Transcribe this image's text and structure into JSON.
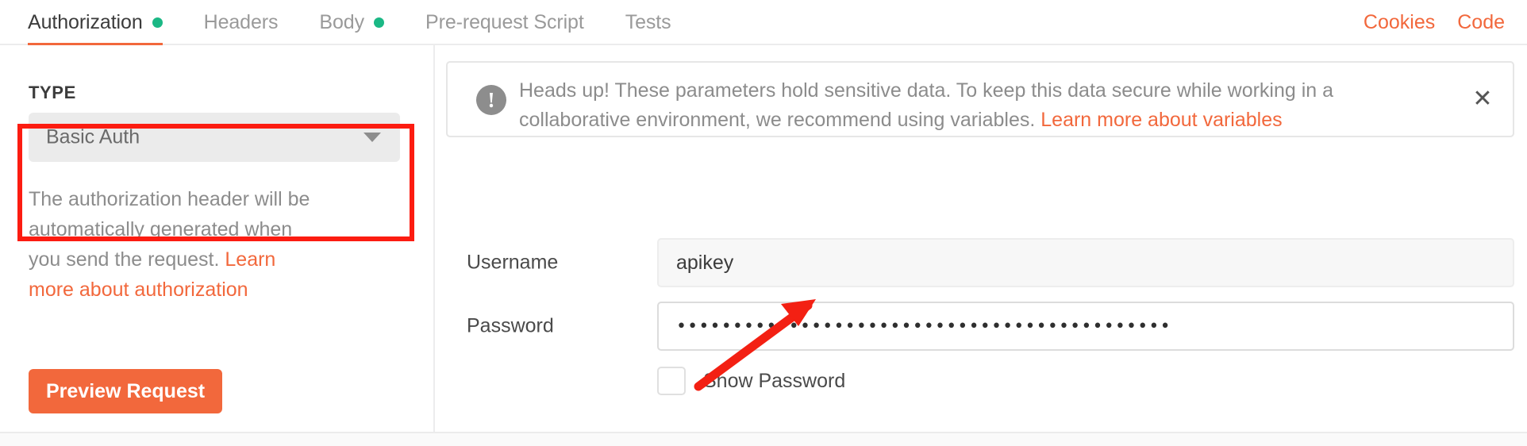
{
  "tabs": [
    {
      "label": "Authorization",
      "active": true,
      "dot": true
    },
    {
      "label": "Headers",
      "active": false,
      "dot": false
    },
    {
      "label": "Body",
      "active": false,
      "dot": true
    },
    {
      "label": "Pre-request Script",
      "active": false,
      "dot": false
    },
    {
      "label": "Tests",
      "active": false,
      "dot": false
    }
  ],
  "header": {
    "cookies_label": "Cookies",
    "code_label": "Code"
  },
  "left_pane": {
    "type_label": "TYPE",
    "type_value": "Basic Auth",
    "help_text_before": "The authorization header will be automatically generated when you send the request. ",
    "help_link": "Learn more about authorization",
    "preview_button": "Preview Request"
  },
  "banner": {
    "icon": "exclamation-icon",
    "icon_glyph": "!",
    "text_before": "Heads up! These parameters hold sensitive data. To keep this data secure while working in a collaborative environment, we recommend using variables. ",
    "link": "Learn more about variables",
    "close_glyph": "✕"
  },
  "form": {
    "username_label": "Username",
    "username_value": "apikey",
    "password_label": "Password",
    "password_value": "••••••••••••••••••••••••••••••••••••••••••••",
    "show_password_label": "Show Password",
    "show_password_checked": false
  },
  "annotations": {
    "box_color": "#fc1c11",
    "arrow_color": "#f32013"
  },
  "colors": {
    "accent": "#f2683c",
    "green_dot": "#1bb885",
    "text_primary": "#3c3c3c",
    "text_muted": "#8c8c8c"
  }
}
